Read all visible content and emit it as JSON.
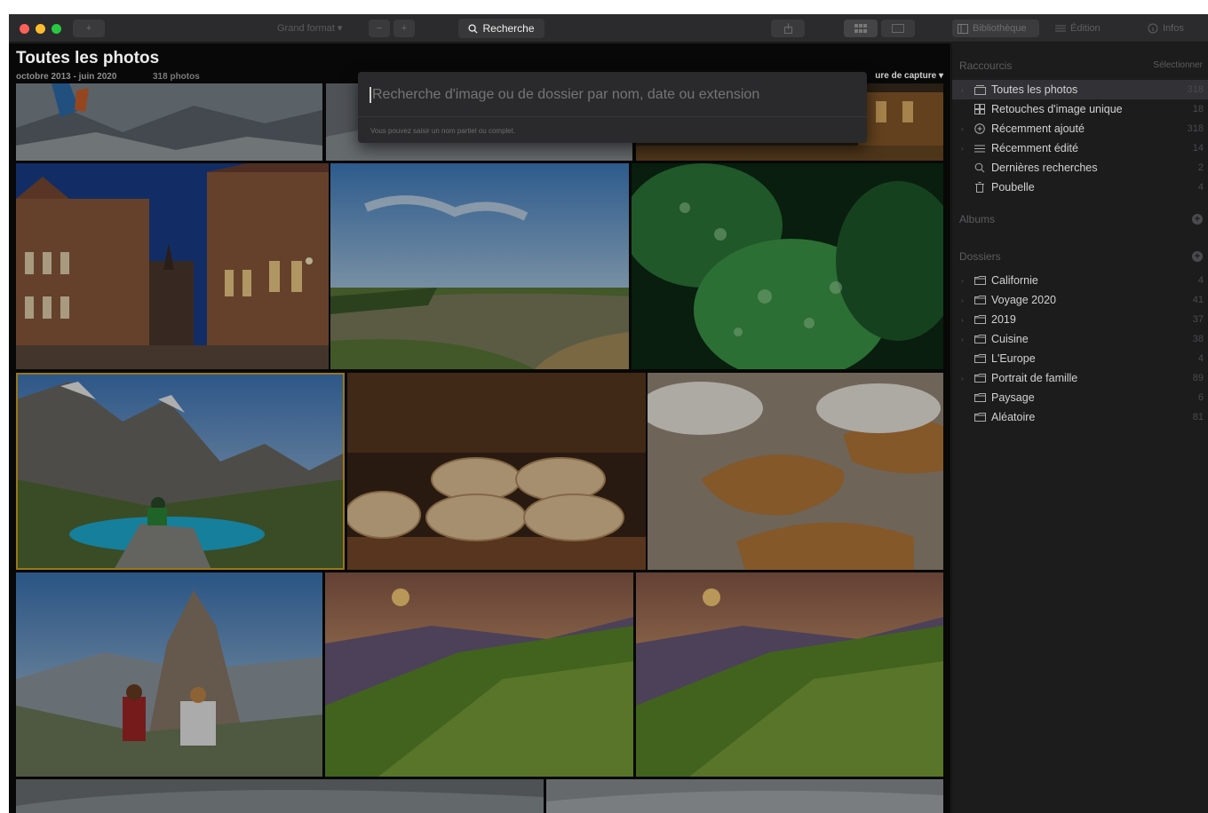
{
  "toolbar": {
    "view_mode": "Grand format",
    "search_label": "Recherche",
    "tabs": [
      {
        "label": "Bibliothèque",
        "icon": "library-icon"
      },
      {
        "label": "Édition",
        "icon": "sliders-icon"
      },
      {
        "label": "Infos",
        "icon": "info-icon"
      }
    ]
  },
  "main": {
    "title": "Toutes les photos",
    "date_range": "octobre 2013 - juin 2020",
    "count": "318 photos",
    "sort_label": "ure de capture",
    "search": {
      "placeholder": "Recherche d'image ou de dossier par nom, date ou extension",
      "hint": "Vous pouvez saisir un nom partiel ou complet."
    },
    "photos": [
      {
        "subject": "mountain-rock-hiker"
      },
      {
        "subject": "rocky-landscape"
      },
      {
        "subject": "town-at-night"
      },
      {
        "subject": "dutch-street-night"
      },
      {
        "subject": "river-aerial"
      },
      {
        "subject": "green-leaves-drops"
      },
      {
        "subject": "mountain-lake-hiker"
      },
      {
        "subject": "bread-display"
      },
      {
        "subject": "baguettes"
      },
      {
        "subject": "couple-mountain"
      },
      {
        "subject": "sunset-hills"
      },
      {
        "subject": "sunset-hills-copy"
      },
      {
        "subject": "cloudy-sky"
      },
      {
        "subject": "cloudy-sky-2"
      }
    ]
  },
  "sidebar": {
    "shortcuts_title": "Raccourcis",
    "select_label": "Sélectionner",
    "shortcuts": [
      {
        "label": "Toutes les photos",
        "count": "318",
        "icon": "photos-icon"
      },
      {
        "label": "Retouches d'image unique",
        "count": "18",
        "icon": "grid-icon"
      },
      {
        "label": "Récemment ajouté",
        "count": "318",
        "icon": "clock-plus-icon"
      },
      {
        "label": "Récemment édité",
        "count": "14",
        "icon": "sliders-icon"
      },
      {
        "label": "Dernières recherches",
        "count": "2",
        "icon": "search-icon"
      },
      {
        "label": "Poubelle",
        "count": "4",
        "icon": "trash-icon"
      }
    ],
    "albums_title": "Albums",
    "folders_title": "Dossiers",
    "folders": [
      {
        "label": "Californie",
        "count": "4"
      },
      {
        "label": "Voyage 2020",
        "count": "41"
      },
      {
        "label": "2019",
        "count": "37"
      },
      {
        "label": "Cuisine",
        "count": "38"
      },
      {
        "label": "L'Europe",
        "count": "4"
      },
      {
        "label": "Portrait de famille",
        "count": "89"
      },
      {
        "label": "Paysage",
        "count": "6"
      },
      {
        "label": "Aléatoire",
        "count": "81"
      }
    ]
  }
}
